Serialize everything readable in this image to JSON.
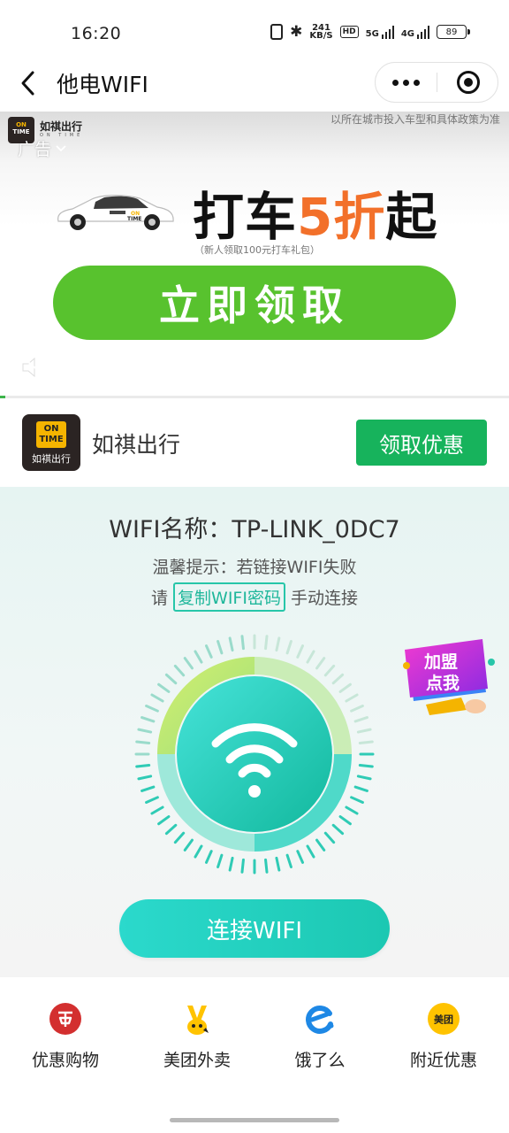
{
  "status_bar": {
    "time": "16:20",
    "net_speed_top": "241",
    "net_speed_bottom": "KB/S",
    "hd_label": "HD",
    "sig1_label": "5G",
    "sig2_label": "4G",
    "battery": "89"
  },
  "navbar": {
    "title": "他电WIFI"
  },
  "ad": {
    "brand_name": "如祺出行",
    "brand_sub": "ON TIME",
    "disclaimer": "以所在城市投入车型和具体政策为准",
    "ad_tag": "广告",
    "headline_pre": "打车",
    "headline_hl": "5折",
    "headline_post": "起",
    "subline": "（新人领取100元打车礼包）",
    "cta_label": "立即领取",
    "progress_fraction": 0.01,
    "accent_color": "#58c22e",
    "highlight_color": "#f2702a"
  },
  "advertiser": {
    "logo_on": "ON",
    "logo_time": "TIME",
    "logo_cn": "如祺出行",
    "name": "如祺出行",
    "button_label": "领取优惠"
  },
  "wifi": {
    "ssid_label": "WIFI名称：",
    "ssid": "TP-LINK_0DC7",
    "tip": "温馨提示：若链接WIFI失败",
    "tip_pre": "请",
    "copy_label": "复制WIFI密码",
    "tip_post": "手动连接",
    "join_label_1": "加盟",
    "join_label_2": "点我",
    "connect_label": "连接WIFI",
    "accent_color": "#1cc8b2"
  },
  "tabs": [
    {
      "label": "优惠购物",
      "icon": "shopping-icon"
    },
    {
      "label": "美团外卖",
      "icon": "meituan-waimai-icon"
    },
    {
      "label": "饿了么",
      "icon": "eleme-icon"
    },
    {
      "label": "附近优惠",
      "icon": "meituan-icon",
      "icon_text": "美团"
    }
  ]
}
